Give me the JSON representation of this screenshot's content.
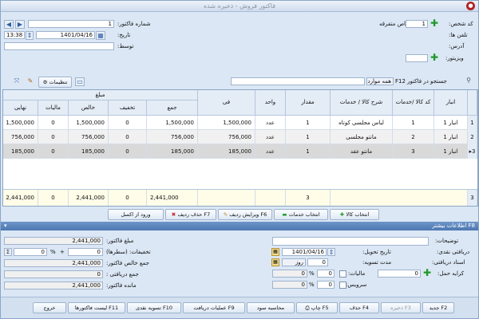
{
  "window": {
    "title": "فاکتور فروش - ذخیره شده"
  },
  "header": {
    "left": {
      "invoice_no_label": "شماره فاکتور:",
      "invoice_no": "1",
      "date_label": "تاریخ:",
      "date": "1401/04/16",
      "time": "13:38",
      "by_label": "توسط:",
      "by_value": ""
    },
    "right": {
      "person_code_label": "کد شخص:",
      "person_code": "1",
      "person_name": "اشخاص متفرقه",
      "phone_label": "تلفن ها:",
      "address_label": "آدرس:",
      "visitor_label": "ویزیتور:",
      "visitor_value": ""
    }
  },
  "toolbar": {
    "settings_label": "تنظیمات",
    "search_label": "جستجو در فاکتور F12",
    "search_scope": "همه موارد",
    "search_value": ""
  },
  "grid": {
    "group_header": "مبلغ",
    "columns": {
      "rownum": "",
      "warehouse": "انبار",
      "code": "کد کالا /خدمات",
      "desc": "شرح کالا / خدمات",
      "qty": "مقدار",
      "unit": "واحد",
      "fee": "فی",
      "total": "جمع",
      "discount": "تخفیف",
      "net": "خالص",
      "tax": "مالیات",
      "final": "نهایی"
    },
    "rows": [
      {
        "n": "1",
        "warehouse": "انبار 1",
        "code": "1",
        "desc": "لباس مجلسی کوتاه",
        "qty": "1",
        "unit": "عدد",
        "fee": "1,500,000",
        "total": "1,500,000",
        "discount": "0",
        "net": "1,500,000",
        "tax": "0",
        "final": "1,500,000"
      },
      {
        "n": "2",
        "warehouse": "انبار 1",
        "code": "2",
        "desc": "مانتو مجلسی",
        "qty": "1",
        "unit": "عدد",
        "fee": "756,000",
        "total": "756,000",
        "discount": "0",
        "net": "756,000",
        "tax": "0",
        "final": "756,000"
      },
      {
        "n": "3",
        "warehouse": "انبار 1",
        "code": "3",
        "desc": "مانتو عقد",
        "qty": "1",
        "unit": "عدد",
        "fee": "185,000",
        "total": "185,000",
        "discount": "0",
        "net": "185,000",
        "tax": "0",
        "final": "185,000"
      }
    ],
    "footer": {
      "count": "3",
      "qty": "3",
      "total": "2,441,000",
      "discount": "0",
      "net": "2,441,000",
      "tax": "0",
      "final": "2,441,000"
    }
  },
  "row_buttons": {
    "select_goods": "انتخاب کالا",
    "select_services": "انتخاب خدمات",
    "edit_row": "ویرایش ردیف F6",
    "delete_row": "حذف ردیف F7",
    "import_excel": "ورود از اکسل"
  },
  "more": {
    "section_title": "F8 اطلاعات بیشتر",
    "left": {
      "amount_label": "مبلغ فاکتور:",
      "amount": "2,441,000",
      "addsub_label": "تخفیفات: (سطرها)",
      "addsub_value": "0",
      "pct": "0",
      "pct_sign": "%",
      "plus_sign": "+",
      "sigma": "Σ",
      "subtotal_label": "جمع خالص فاکتور:",
      "subtotal": "2,441,000",
      "received_label": "جمع دریافتی :",
      "received": "0",
      "balance_label": "مانده فاکتور:",
      "balance": "2,441,000"
    },
    "right": {
      "notes_label": "توضیحات:",
      "cash_label": "دریافتی نقدی:",
      "delivery_label": "تاریخ تحویل:",
      "delivery_date": "1401/04/16",
      "settle_label": "مدت تسویه:",
      "settle_days": "0",
      "settle_unit": "روز",
      "docs_label": "اسناد دریافتی:",
      "tax_label": "مالیات:",
      "tax_value": "0",
      "tax_pct": "0",
      "pct_sign": "%",
      "shipping_label": "کرایه حمل:",
      "shipping": "0",
      "service_label": "سرویس:",
      "service_value": "0",
      "service_pct": "0"
    }
  },
  "bottom": {
    "new": "جدید F2",
    "save": "ذخیره F3",
    "delete": "حذف F4",
    "print": "چاپ F5",
    "profit": "محاسبه سود",
    "receive_ops": "عملیات دریافت F9",
    "cash_settle": "تسویه نقدی F10",
    "invoice_list": "لیست فاکتورها F11",
    "exit": "خروج"
  },
  "colors": {
    "accent": "#4d77b0",
    "plus": "#1f9a2a",
    "footer_row": "#fffde8"
  }
}
